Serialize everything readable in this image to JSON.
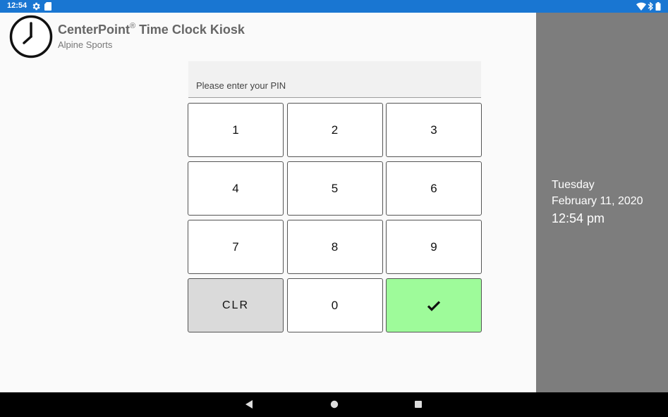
{
  "status_bar": {
    "time": "12:54",
    "icons": [
      "settings-gear-icon",
      "sd-card-icon",
      "wifi-icon",
      "bluetooth-icon",
      "battery-icon"
    ],
    "color": "#1976d2"
  },
  "header": {
    "title": "CenterPoint",
    "trademark": "®",
    "title_suffix": " Time Clock Kiosk",
    "subtitle": "Alpine Sports",
    "icon": "clock-icon"
  },
  "pin": {
    "placeholder": "Please enter your PIN",
    "value": ""
  },
  "keypad": {
    "keys": [
      "1",
      "2",
      "3",
      "4",
      "5",
      "6",
      "7",
      "8",
      "9",
      "CLR",
      "0"
    ],
    "submit_icon": "checkmark-icon",
    "submit_color": "#9efb9a",
    "clear_color": "#dadada"
  },
  "side_panel": {
    "day": "Tuesday",
    "date": "February 11, 2020",
    "time": "12:54 pm",
    "background": "#7d7d7d"
  },
  "nav_bar": {
    "icons": [
      "back-icon",
      "home-icon",
      "recents-icon"
    ]
  }
}
